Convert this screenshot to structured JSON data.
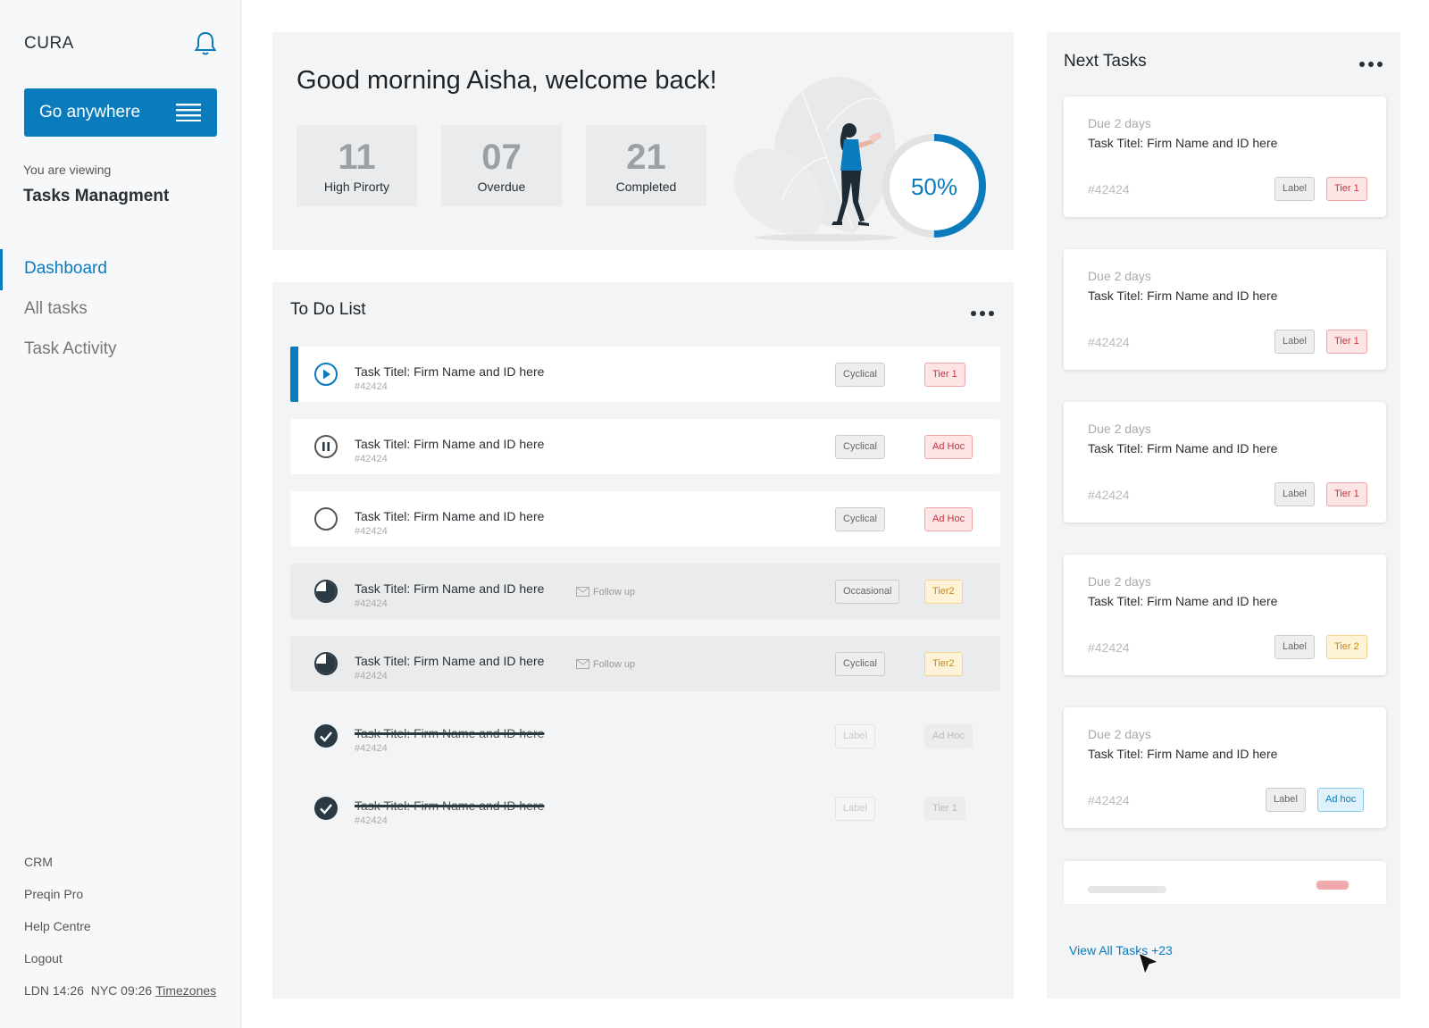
{
  "sidebar": {
    "brand": "CURA",
    "go_button": "Go anywhere",
    "viewing_label": "You are viewing",
    "viewing_title": "Tasks Managment",
    "nav": [
      "Dashboard",
      "All tasks",
      "Task Activity"
    ],
    "footer_links": [
      "CRM",
      "Preqin Pro",
      "Help Centre",
      "Logout"
    ],
    "times": "LDN 14:26  NYC 09:26",
    "timezones_link": "Timezones",
    "accent_color": "#0a7bbd"
  },
  "welcome": {
    "greeting": "Good morning Aisha, welcome back!",
    "stats": [
      {
        "value": "11",
        "label": "High Pirorty"
      },
      {
        "value": "07",
        "label": "Overdue"
      },
      {
        "value": "21",
        "label": "Completed"
      }
    ],
    "progress_label": "50%",
    "progress_fraction": 0.5
  },
  "todo": {
    "title": "To Do List",
    "rows": [
      {
        "status": "play-icon",
        "title": "Task Titel: Firm Name and ID here",
        "id": "#42424",
        "category": "Cyclical",
        "tier": "Tier 1",
        "follow": ""
      },
      {
        "status": "pause-icon",
        "title": "Task Titel: Firm Name and ID here",
        "id": "#42424",
        "category": "Cyclical",
        "tier": "Ad Hoc",
        "follow": ""
      },
      {
        "status": "empty-circle-icon",
        "title": "Task Titel: Firm Name and ID here",
        "id": "#42424",
        "category": "Cyclical",
        "tier": "Ad Hoc",
        "follow": ""
      },
      {
        "status": "partial-progress-icon",
        "title": "Task Titel: Firm Name and ID here",
        "id": "#42424",
        "category": "Occasional",
        "tier": "Tier2",
        "follow": "Follow up"
      },
      {
        "status": "partial-progress-icon",
        "title": "Task Titel: Firm Name and ID here",
        "id": "#42424",
        "category": "Cyclical",
        "tier": "Tier2",
        "follow": "Follow up"
      },
      {
        "status": "check-icon",
        "title": "Task Titel: Firm Name and ID here",
        "id": "#42424",
        "category": "Label",
        "tier": "Ad Hoc",
        "follow": ""
      },
      {
        "status": "check-icon",
        "title": "Task Titel: Firm Name and ID here",
        "id": "#42424",
        "category": "Label",
        "tier": "Tier 1",
        "follow": ""
      }
    ]
  },
  "next_tasks": {
    "title": "Next Tasks",
    "cards": [
      {
        "due": "Due 2 days",
        "title": "Task Titel: Firm Name and ID here",
        "id": "#42424",
        "label": "Label",
        "tier": "Tier 1"
      },
      {
        "due": "Due 2 days",
        "title": "Task Titel: Firm Name and ID here",
        "id": "#42424",
        "label": "Label",
        "tier": "Tier 1"
      },
      {
        "due": "Due 2 days",
        "title": "Task Titel: Firm Name and ID here",
        "id": "#42424",
        "label": "Label",
        "tier": "Tier 1"
      },
      {
        "due": "Due 2 days",
        "title": "Task Titel: Firm Name and ID here",
        "id": "#42424",
        "label": "Label",
        "tier": "Tier 2"
      },
      {
        "due": "Due 2 days",
        "title": "Task Titel: Firm Name and ID here",
        "id": "#42424",
        "label": "Label",
        "tier": "Ad hoc"
      }
    ],
    "view_all": "View All Tasks +23"
  }
}
